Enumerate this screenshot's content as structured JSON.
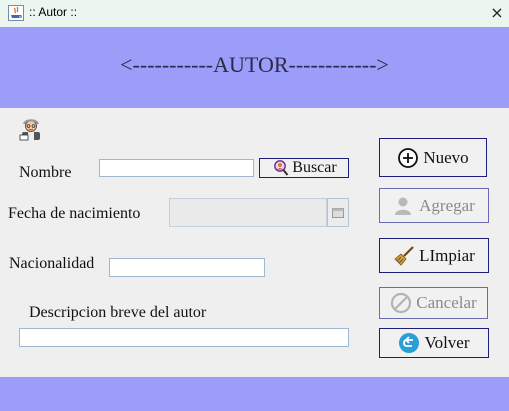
{
  "window": {
    "title": ":: Autor ::",
    "close_glyph": "×"
  },
  "header": {
    "title": "<-----------AUTOR------------>"
  },
  "form": {
    "nombre_label": "Nombre",
    "nombre_value": "",
    "fecha_label": "Fecha de nacimiento",
    "fecha_value": "",
    "nacionalidad_label": "Nacionalidad",
    "nacionalidad_value": "",
    "descripcion_label": "Descripcion breve del autor",
    "descripcion_value": ""
  },
  "buttons": {
    "buscar": "Buscar",
    "nuevo": "Nuevo",
    "agregar": "Agregar",
    "limpiar": "LImpiar",
    "cancelar": "Cancelar",
    "volver": "Volver"
  },
  "icons": {
    "app": "java-icon",
    "author": "author-avatar-icon",
    "buscar": "search-person-icon",
    "nuevo": "plus-circle-icon",
    "agregar": "user-icon",
    "limpiar": "broom-icon",
    "cancelar": "prohibit-icon",
    "volver": "back-arrow-icon",
    "calendar": "calendar-icon"
  },
  "colors": {
    "band": "#9c9cf9",
    "titlebar": "#ebf7ee",
    "button_border": "#1e1e7a",
    "volver_icon": "#2a9fd6"
  }
}
